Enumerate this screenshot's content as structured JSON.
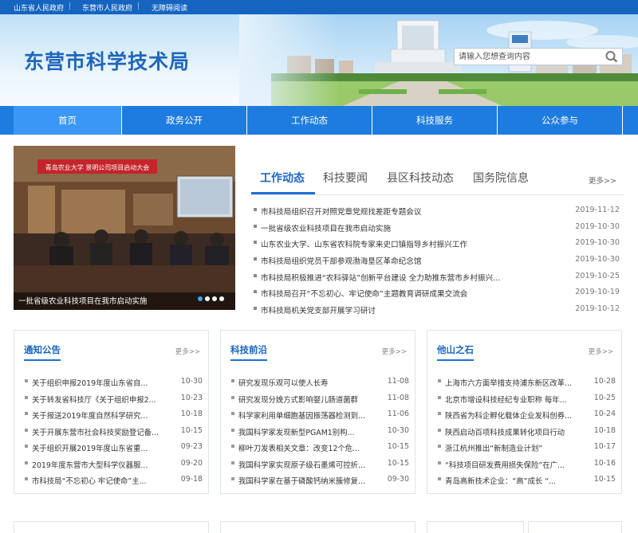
{
  "topbar": {
    "links": [
      "山东省人民政府",
      "东营市人民政府",
      "无障碍阅读"
    ],
    "separator": "|"
  },
  "header": {
    "site_title": "东营市科学技术局",
    "search_placeholder": "请输入您想查询内容"
  },
  "nav": {
    "items": [
      "首页",
      "政务公开",
      "工作动态",
      "科技服务",
      "公众参与"
    ],
    "active_index": 0
  },
  "carousel": {
    "banner_text": "青岛农业大学 景明公司项目启动大会",
    "caption": "一批省级农业科技项目在我市启动实施",
    "dot_count": 4,
    "active_dot": 0
  },
  "news": {
    "tabs": [
      "工作动态",
      "科技要闻",
      "县区科技动态",
      "国务院信息"
    ],
    "active_tab": 0,
    "more": "更多>>",
    "items": [
      {
        "title": "市科技局组织召开对照党章党规找差距专题会议",
        "date": "2019-11-12"
      },
      {
        "title": "一批省级农业科技项目在我市启动实施",
        "date": "2019-10-30"
      },
      {
        "title": "山东农业大学、山东省农科院专家来史口镇指导乡村振兴工作",
        "date": "2019-10-30"
      },
      {
        "title": "市科技局组织党员干部参观渤海垦区革命纪念馆",
        "date": "2019-10-30"
      },
      {
        "title": "市科技局积极推进“农科驿站”创新平台建设 全力助推东营市乡村振兴...",
        "date": "2019-10-25"
      },
      {
        "title": "市科技局召开“不忘初心、牢记使命”主题教育调研成果交流会",
        "date": "2019-10-19"
      },
      {
        "title": "市科技局机关党支部开展学习研讨",
        "date": "2019-10-12"
      }
    ]
  },
  "boxes": [
    {
      "title": "通知公告",
      "more": "更多>>",
      "items": [
        {
          "title": "关于组织申报2019年度山东省自...",
          "date": "10-30"
        },
        {
          "title": "关于转发省科技厅《关于组织申报2...",
          "date": "10-23"
        },
        {
          "title": "关于报送2019年度自然科学研究...",
          "date": "10-18"
        },
        {
          "title": "关于开展东营市社会科技奖励登记备...",
          "date": "10-15"
        },
        {
          "title": "关于组织开展2019年度山东省重...",
          "date": "09-23"
        },
        {
          "title": "2019年度东营市大型科学仪器服...",
          "date": "09-20"
        },
        {
          "title": "市科技局“不忘初心 牢记使命”主...",
          "date": "09-18"
        }
      ]
    },
    {
      "title": "科技前沿",
      "more": "更多>>",
      "items": [
        {
          "title": "研究发现乐观可以使人长寿",
          "date": "11-08"
        },
        {
          "title": "研究发现分娩方式影响婴儿肠道菌群",
          "date": "11-08"
        },
        {
          "title": "科学家利用单细胞基因振荡器检测到...",
          "date": "11-06"
        },
        {
          "title": "我国科学家发现新型PGAM1别构...",
          "date": "10-30"
        },
        {
          "title": "柳叶刀发表相关文章：改变12个危...",
          "date": "10-15"
        },
        {
          "title": "我国科学家实现原子级石墨烯可控折...",
          "date": "10-15"
        },
        {
          "title": "我国科学家在基于磷酸钙纳米簇修复...",
          "date": "09-30"
        }
      ]
    },
    {
      "title": "他山之石",
      "more": "更多>>",
      "items": [
        {
          "title": "上海市六方面举措支持浦东新区改革...",
          "date": "10-28"
        },
        {
          "title": "北京市增设科技经纪专业职称 每年...",
          "date": "10-25"
        },
        {
          "title": "陕西省为科企孵化载体企业发科创券...",
          "date": "10-24"
        },
        {
          "title": "陕西启动百项科技成果转化项目行动",
          "date": "10-18"
        },
        {
          "title": "浙江杭州推出“新制造业计划”",
          "date": "10-17"
        },
        {
          "title": "“科技项目研发费用损失保险”在广...",
          "date": "10-16"
        },
        {
          "title": "青岛高新技术企业：“高”成长 “...",
          "date": "10-15"
        }
      ]
    }
  ],
  "colors": {
    "brand_blue": "#1e7ce0",
    "title_blue": "#1f66bd",
    "nav_active": "#3a97f5"
  }
}
